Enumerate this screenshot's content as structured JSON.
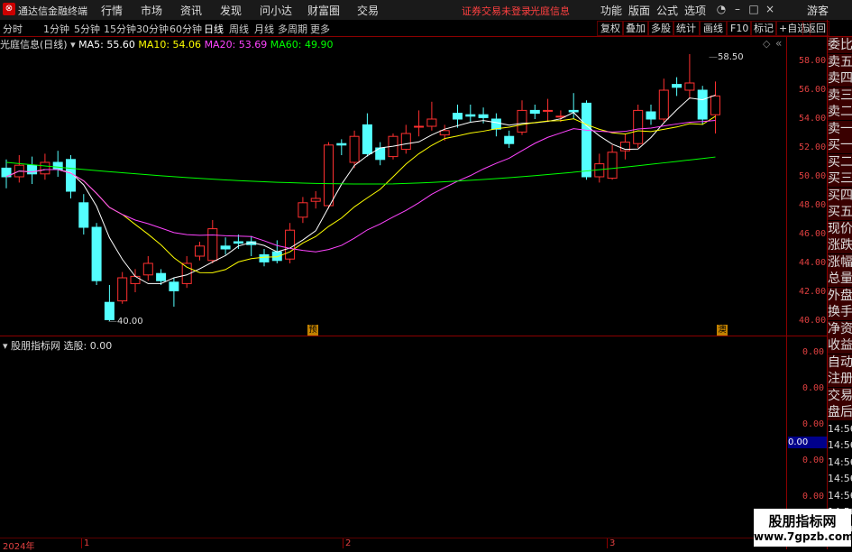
{
  "app": {
    "title": "通达信金融终端",
    "logo": "logo-icon"
  },
  "menu": [
    "行情",
    "市场",
    "资讯",
    "发现",
    "问小达",
    "财富圈",
    "交易"
  ],
  "status": {
    "login_text": "证券交易未登录",
    "stock_name": "光庭信息"
  },
  "right_menu": [
    "功能",
    "版面",
    "公式",
    "选项"
  ],
  "guest": "游客",
  "periods": [
    "分时",
    "1分钟",
    "5分钟",
    "15分钟",
    "30分钟",
    "60分钟",
    "日线",
    "周线",
    "月线",
    "多周期",
    "更多"
  ],
  "active_period": "日线",
  "tools": [
    "复权",
    "叠加",
    "多股",
    "统计",
    "画线",
    "F10",
    "标记",
    "+自选",
    "返回"
  ],
  "header": {
    "name": "光庭信息(日线)",
    "ma5": "MA5: 55.60",
    "ma10": "MA10: 54.06",
    "ma20": "MA20: 53.69",
    "ma60": "MA60: 49.90",
    "ma5_color": "#ffffff",
    "ma10_color": "#ffff00",
    "ma20_color": "#ff44ff",
    "ma60_color": "#00ff00"
  },
  "y_ticks": [
    "58.00",
    "56.00",
    "54.00",
    "52.00",
    "50.00",
    "48.00",
    "46.00",
    "44.00",
    "42.00",
    "40.00"
  ],
  "annotations": {
    "high": "58.50",
    "low": "40.00",
    "mark1": "预",
    "mark2": "澳"
  },
  "indicator": {
    "title": "股朋指标网",
    "label": "选股: 0.00",
    "y_ticks": [
      "0.00",
      "0.00",
      "0.00",
      "0.00",
      "0.00",
      "0.00"
    ],
    "current": "0.00"
  },
  "side_labels": [
    "委比",
    "卖五",
    "卖四",
    "卖三",
    "卖二",
    "卖一",
    "买一",
    "买二",
    "买三",
    "买四",
    "买五",
    "现价",
    "涨跌",
    "涨幅",
    "总量",
    "外盘",
    "换手",
    "净资",
    "收益",
    "自动",
    "注册",
    "交易",
    "盘后",
    "14:56",
    "14:56",
    "14:56",
    "14:56",
    "14:56",
    "14:56",
    "14:56"
  ],
  "x_labels": [
    "2024年",
    "1",
    "2",
    "3"
  ],
  "watermark": {
    "line1": "股朋指标网",
    "line2": "www.7gpzb.com"
  }
}
